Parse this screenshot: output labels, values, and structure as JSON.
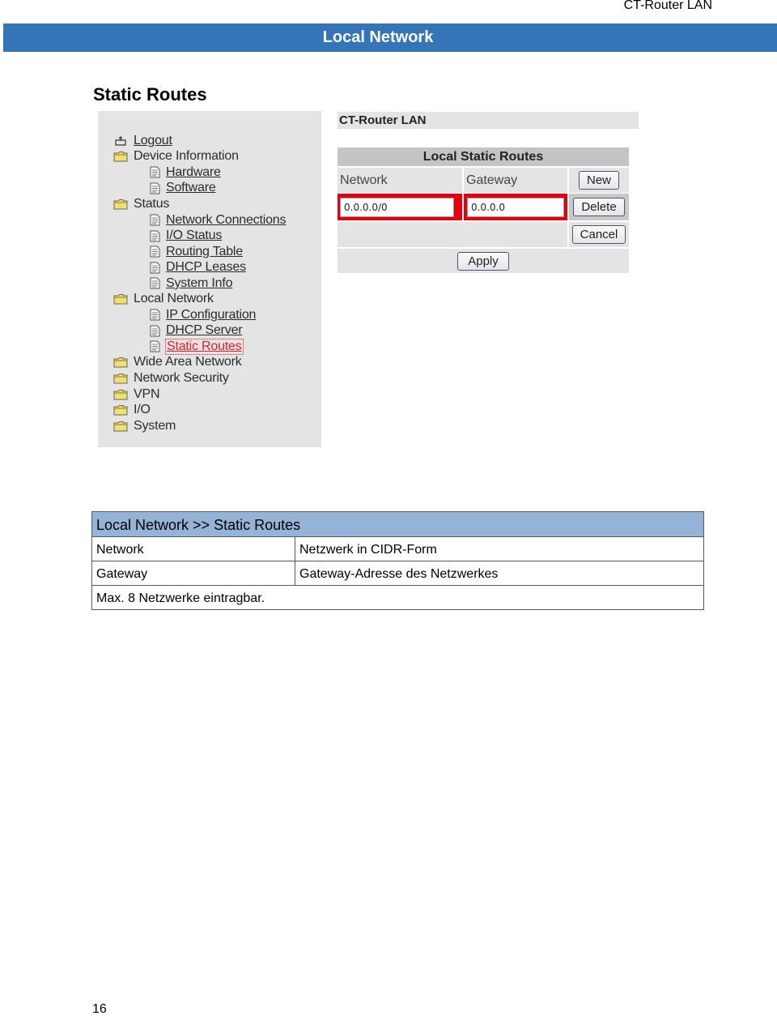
{
  "document": {
    "running_header": "CT-Router LAN",
    "section_title": "Local Network",
    "page_title": "Static Routes",
    "page_number": "16"
  },
  "navigation": {
    "items": [
      {
        "label": "Logout",
        "icon": "logout-icon",
        "level": 0,
        "link": true
      },
      {
        "label": "Device Information",
        "icon": "folder-icon",
        "level": 0,
        "link": false
      },
      {
        "label": "Hardware",
        "icon": "page-icon",
        "level": 1,
        "link": true
      },
      {
        "label": "Software",
        "icon": "page-icon",
        "level": 1,
        "link": true
      },
      {
        "label": "Status",
        "icon": "folder-icon",
        "level": 0,
        "link": false
      },
      {
        "label": "Network Connections",
        "icon": "page-icon",
        "level": 1,
        "link": true
      },
      {
        "label": "I/O Status",
        "icon": "page-icon",
        "level": 1,
        "link": true
      },
      {
        "label": "Routing Table",
        "icon": "page-icon",
        "level": 1,
        "link": true
      },
      {
        "label": "DHCP Leases",
        "icon": "page-icon",
        "level": 1,
        "link": true
      },
      {
        "label": "System Info",
        "icon": "page-icon",
        "level": 1,
        "link": true
      },
      {
        "label": "Local Network",
        "icon": "folder-icon",
        "level": 0,
        "link": false
      },
      {
        "label": "IP Configuration",
        "icon": "page-icon",
        "level": 1,
        "link": true
      },
      {
        "label": "DHCP Server",
        "icon": "page-icon",
        "level": 1,
        "link": true
      },
      {
        "label": "Static Routes",
        "icon": "page-icon",
        "level": 1,
        "link": true,
        "active": true
      },
      {
        "label": "Wide Area Network",
        "icon": "folder-icon",
        "level": 0,
        "link": false
      },
      {
        "label": "Network Security",
        "icon": "folder-icon",
        "level": 0,
        "link": false
      },
      {
        "label": "VPN",
        "icon": "folder-icon",
        "level": 0,
        "link": false
      },
      {
        "label": "I/O",
        "icon": "folder-icon",
        "level": 0,
        "link": false
      },
      {
        "label": "System",
        "icon": "folder-icon",
        "level": 0,
        "link": false
      }
    ],
    "colors": {
      "active": "#e0202a",
      "folder": "#f0e070"
    }
  },
  "form": {
    "app_title": "CT-Router LAN",
    "table_title": "Local Static Routes",
    "network_header": "Network",
    "gateway_header": "Gateway",
    "network_value": "0.0.0.0/0",
    "gateway_value": "0.0.0.0",
    "buttons": {
      "new": "New",
      "delete": "Delete",
      "cancel": "Cancel",
      "apply": "Apply"
    },
    "highlight_color": "#e3000f"
  },
  "description": {
    "header": "Local Network >> Static Routes",
    "rows": [
      {
        "term": "Network",
        "definition": "Netzwerk in CIDR-Form"
      },
      {
        "term": "Gateway",
        "definition": "Gateway-Adresse des Netzwerkes"
      }
    ],
    "note": "Max. 8 Netzwerke eintragbar."
  }
}
